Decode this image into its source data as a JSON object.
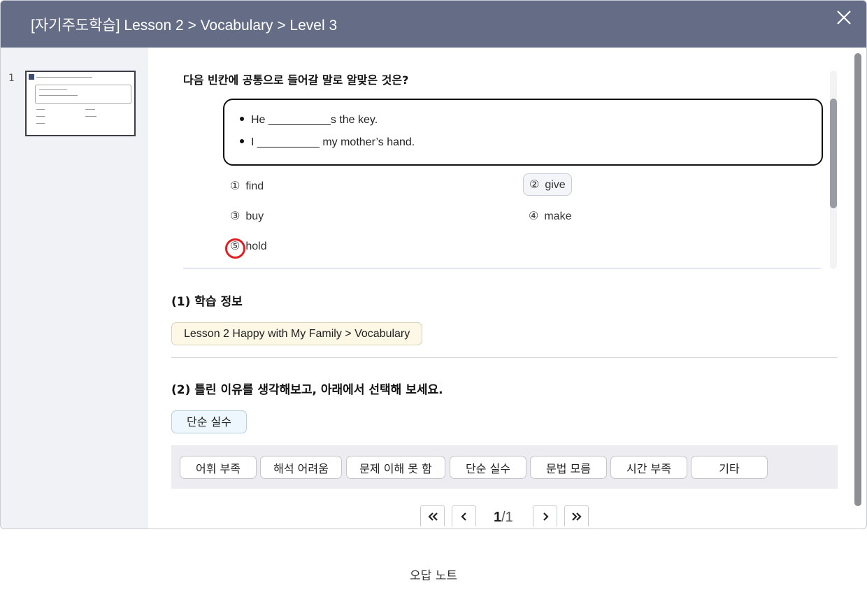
{
  "header": {
    "title": "[자기주도학습] Lesson 2 > Vocabulary > Level 3"
  },
  "sidebar": {
    "items": [
      {
        "number": "1"
      }
    ]
  },
  "question": {
    "prompt": "다음 빈칸에 공통으로 들어갈 말로 알맞은 것은?",
    "sentences": [
      "He __________s the key.",
      "I __________ my mother’s hand."
    ],
    "options": [
      {
        "num": "①",
        "text": "find"
      },
      {
        "num": "②",
        "text": "give",
        "selected": true
      },
      {
        "num": "③",
        "text": "buy"
      },
      {
        "num": "④",
        "text": "make"
      },
      {
        "num": "⑤",
        "text": "hold",
        "correct": true
      }
    ]
  },
  "section1": {
    "title": "(1) 학습 정보",
    "info_chip": "Lesson 2 Happy with My Family > Vocabulary"
  },
  "section2": {
    "title": "(2) 틀린 이유를 생각해보고, 아래에서 선택해 보세요.",
    "selected_reason": "단순 실수",
    "reasons": [
      "어휘 부족",
      "해석 어려움",
      "문제 이해 못 함",
      "단순 실수",
      "문법 모름",
      "시간 부족",
      "기타"
    ]
  },
  "pager": {
    "current": "1",
    "total": "/1"
  },
  "footer": {
    "label": "오답 노트"
  },
  "colors": {
    "header_bg": "#646d85",
    "mark": "#e02020"
  }
}
